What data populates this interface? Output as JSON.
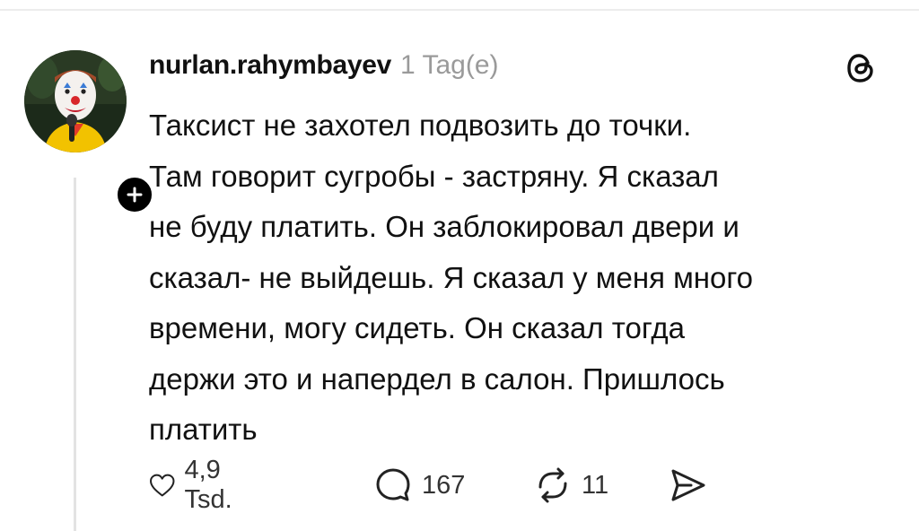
{
  "post": {
    "username": "nurlan.rahymbayev",
    "time": "1 Tag(e)",
    "text": "Таксист не захотел подвозить до точки.\nТам говорит сугробы - застряну. Я сказал\nне буду платить. Он заблокировал двери и\nсказал- не выйдешь. Я сказал у меня много\nвремени, могу сидеть. Он сказал тогда\nдержи это и напердел в салон. Пришлось\nплатить"
  },
  "actions": {
    "like_count": "4,9 Tsd.",
    "reply_count": "167",
    "repost_count": "11"
  },
  "icons": {
    "avatar": "clown-avatar",
    "follow": "plus-icon",
    "brand": "threads-logo-icon",
    "like": "heart-icon",
    "reply": "comment-bubble-icon",
    "repost": "repost-icon",
    "share": "send-icon"
  },
  "colors": {
    "text": "#111111",
    "muted": "#9a9a9a",
    "divider": "#e3e3e3",
    "follow_button": "#000000"
  }
}
